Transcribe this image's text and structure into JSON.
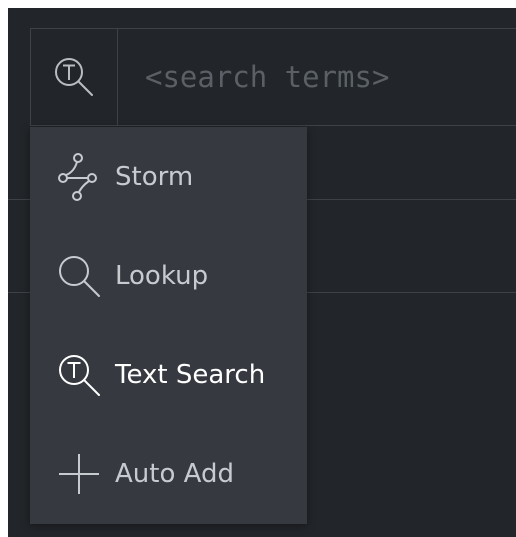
{
  "search": {
    "placeholder": "<search terms>",
    "mode_icon": "text-search-icon"
  },
  "menu": {
    "items": [
      {
        "label": "Storm",
        "icon": "storm-icon",
        "active": false
      },
      {
        "label": "Lookup",
        "icon": "lookup-icon",
        "active": false
      },
      {
        "label": "Text Search",
        "icon": "text-search-icon",
        "active": true
      },
      {
        "label": "Auto Add",
        "icon": "plus-icon",
        "active": false
      }
    ]
  },
  "colors": {
    "background": "#222529",
    "menu_background": "#363a40",
    "border": "#3d4248",
    "text": "#c6cbd0",
    "text_active": "#ffffff",
    "placeholder": "#5a6066"
  }
}
